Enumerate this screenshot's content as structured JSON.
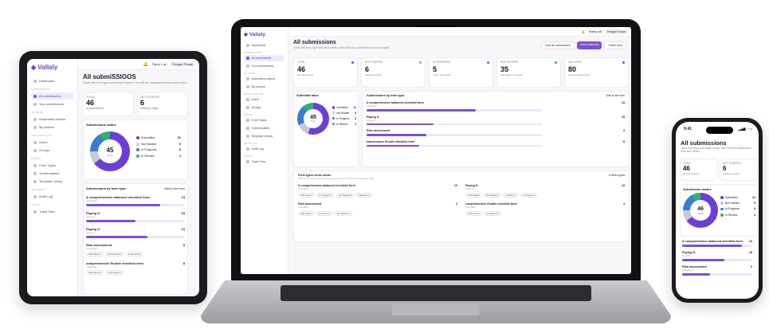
{
  "laptop": {
    "logo": "Vallaly",
    "nav": [
      {
        "label": "Dashboard",
        "section": ""
      },
      {
        "label": "All submissions",
        "section": "Submissions",
        "active": true
      },
      {
        "label": "Your submissions",
        "section": ""
      },
      {
        "label": "Automated actions",
        "section": "Actions"
      },
      {
        "label": "My actions",
        "section": ""
      },
      {
        "label": "Users",
        "section": "Organization"
      },
      {
        "label": "Groups",
        "section": ""
      },
      {
        "label": "Form Types",
        "section": "Forms"
      },
      {
        "label": "Yeartemplates",
        "section": ""
      },
      {
        "label": "Template Library",
        "section": ""
      },
      {
        "label": "Audit Log",
        "section": "Settings"
      },
      {
        "label": "Trash View",
        "section": "Trash"
      }
    ],
    "top": {
      "user": "Yeahly nat",
      "badge": "Fengsh Fouse"
    },
    "title": "All submissions",
    "subtitle": "Track with form type and stack meals, from drill the submissions that need action.",
    "buttons": {
      "view_all": "View all submissions",
      "primary": "Add Provisions",
      "filter": "Power item"
    },
    "stats": [
      {
        "label": "TOTAL",
        "value": "46",
        "sub": "All submissions",
        "dot": "#7b4fd9"
      },
      {
        "label": "NOT STARTED",
        "value": "6",
        "sub": "Waiting to begin",
        "dot": "#9a9aa8"
      },
      {
        "label": "IN PROGRESS",
        "value": "5",
        "sub": "Cost'n ornay filed",
        "dot": "#3a7bd5"
      },
      {
        "label": "DUE RELEASE",
        "value": "35",
        "sub": "Submitted 1 in review",
        "dot": "#2fb36b"
      },
      {
        "label": "AND DONE",
        "value": "80",
        "sub": "Success submissions",
        "dot": "#7b4fd9"
      }
    ],
    "status_card": {
      "title": "Submitdd tatus",
      "center_value": "45",
      "center_label": "Totals",
      "legend": [
        {
          "label": "Submitted",
          "value": "21",
          "color": "#6a3fd6"
        },
        {
          "label": "Not Started",
          "value": "5",
          "color": "#c9c9d6"
        },
        {
          "label": "In Progress",
          "value": "8",
          "color": "#3a7bd5"
        },
        {
          "label": "In Review",
          "value": "4",
          "color": "#2fb36b"
        }
      ]
    },
    "formtype_card": {
      "title": "Submissions by form type",
      "link": "Click to see form",
      "rows": [
        {
          "name": "A comprehensive balanced checklist form",
          "sub": "4 Modules",
          "value": "13",
          "fill": 0.62
        },
        {
          "name": "Paying I1",
          "sub": "2 Forms",
          "value": "15",
          "fill": 0.38
        },
        {
          "name": "Risk assessment",
          "sub": "",
          "value": "3",
          "fill": 0.34
        },
        {
          "name": "maintenance Enoble checklist form",
          "sub": "",
          "value": "8",
          "fill": 0.3
        }
      ]
    },
    "lower_card": {
      "title": "Form types items needs",
      "subtitle": "Quick view of item types and the status in each of these last integration types.",
      "link": "8 Best types",
      "items": [
        {
          "name": "A comprehensive balanced checklist form",
          "sub": "4 Modules",
          "count": "13",
          "chips": [
            "Submitted 3",
            "In Progress 2",
            "Not Started 5",
            "In Review 3"
          ]
        },
        {
          "name": "Paying I1",
          "sub": "2 Forms",
          "count": "13",
          "chips": [
            "Submitted 3",
            "Not Started 4",
            "In Plione 3",
            "In Progress 3"
          ]
        },
        {
          "name": "Risk assessment",
          "sub": "4 Modules",
          "count": "3",
          "chips": [
            "Submitted 1",
            "In Review 1",
            "Not Started 1"
          ]
        },
        {
          "name": "comprehensive Enoble checklist form",
          "sub": "4 Modules",
          "count": "3",
          "chips": [
            "Submitted 3",
            "In Progress 2"
          ]
        }
      ]
    }
  },
  "tablet": {
    "logo": "Vallaly",
    "top": {
      "user": "Fairly 1 at",
      "badge": "Fengsh Fouse"
    },
    "nav": [
      "Dashboard",
      "All submissions",
      "Your submissions",
      "Automated Actions",
      "My Actions",
      "Users",
      "Groups",
      "Form Types",
      "Yourtemplates",
      "Template Library",
      "Audit Log",
      "Trash View"
    ],
    "nav_sections": [
      "",
      "Submissions",
      "",
      "Actions",
      "",
      "Organization",
      "",
      "Forms",
      "",
      "",
      "Settings",
      "Trash"
    ],
    "title": "All submiSSlOOS",
    "subtitle": "Track with form type-performant meals, from drill the submissions that need action.",
    "stats": [
      {
        "label": "TOTAL",
        "value": "46",
        "sub": "All submissions"
      },
      {
        "label": "NOT STARTED",
        "value": "6",
        "sub": "Waiting to begin"
      }
    ],
    "status_title": "Submissions status",
    "center_value": "45",
    "center_label": "Totals",
    "legend": [
      {
        "label": "Submitted",
        "value": "31",
        "color": "#6a3fd6"
      },
      {
        "label": "Not Started",
        "value": "5",
        "color": "#c9c9d6"
      },
      {
        "label": "In Progress",
        "value": "8",
        "color": "#3a7bd5"
      },
      {
        "label": "In Review",
        "value": "4",
        "color": "#2fb36b"
      }
    ],
    "formtype_title": "Submissions by form type",
    "formtype_link": "Click to see form",
    "rows": [
      {
        "name": "A comprehensive balanced checklist form",
        "sub": "4 Modules",
        "value": "13",
        "fill": 0.75
      },
      {
        "name": "Paying I1",
        "sub": "2 Forms",
        "value": "15",
        "fill": 0.5
      },
      {
        "name": "Paying I1",
        "sub": "2 Forms",
        "value": "13",
        "fill": 0.62
      },
      {
        "name": "Risk assessment",
        "sub": "4 Modules",
        "value": "8",
        "chips": [
          "Submitted 3",
          "Not Started 3",
          "In Review 3"
        ]
      },
      {
        "name": "comprehensive Enoble checklist form",
        "sub": "4 Modules",
        "value": "8",
        "chips": [
          "Submitted 3",
          "In Progress 2"
        ]
      }
    ]
  },
  "phone": {
    "time": "9:41",
    "title": "All submissions",
    "subtitle": "Track form type and stack meals, then drill the submissions that need action.",
    "stats": [
      {
        "label": "TOTAL",
        "value": "46",
        "sub": "All submissions"
      },
      {
        "label": "NOT STARTED",
        "value": "6",
        "sub": "Waiting to begin"
      }
    ],
    "status_title": "Submission status",
    "center_value": "46",
    "center_label": "Totals",
    "legend": [
      {
        "label": "Submitted",
        "value": "31",
        "color": "#6a3fd6"
      },
      {
        "label": "Not Started",
        "value": "5",
        "color": "#c9c9d6"
      },
      {
        "label": "In Progress",
        "value": "8",
        "color": "#3a7bd5"
      },
      {
        "label": "In Review",
        "value": "4",
        "color": "#2fb36b"
      }
    ],
    "rows": [
      {
        "name": "A comprehensive balanced checklist form",
        "value": "13",
        "fill": 0.85
      },
      {
        "name": "Paying I1",
        "sub": "2 Forms",
        "value": "15",
        "fill": 0.6
      },
      {
        "name": "Risk assessment",
        "sub": "4 Modules",
        "value": "3",
        "fill": 0.4
      }
    ]
  },
  "colors": {
    "accent": "#7b4fd9",
    "accent_light": "#efeafd"
  }
}
